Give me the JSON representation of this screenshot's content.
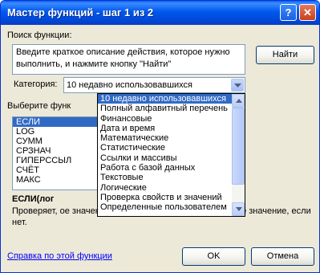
{
  "window": {
    "title": "Мастер функций - шаг 1 из 2",
    "help_glyph": "?",
    "close_glyph": "✕"
  },
  "search": {
    "label": "Поиск функции:",
    "text": "Введите краткое описание действия, которое нужно выполнить, и нажмите кнопку \"Найти\"",
    "find_button": "Найти"
  },
  "category": {
    "label": "Категория:",
    "selected": "10 недавно использовавшихся"
  },
  "functions": {
    "label": "Выберите функ",
    "items": [
      "ЕСЛИ",
      "LOG",
      "СУММ",
      "СРЗНАЧ",
      "ГИПЕРССЫЛ",
      "СЧЁТ",
      "МАКС"
    ],
    "selected_index": 0
  },
  "category_dropdown": {
    "items": [
      "10 недавно использовавшихся",
      "Полный алфавитный перечень",
      "Финансовые",
      "Дата и время",
      "Математические",
      "Статистические",
      "Ссылки и массивы",
      "Работа с базой данных",
      "Текстовые",
      "Логические",
      "Проверка свойств и значений",
      "Определенные пользователем"
    ],
    "selected_index": 0
  },
  "description": {
    "signature": "ЕСЛИ(лог",
    "text": "Проверяет,                                                                         ое значение, если оно выполняется, и другое значение, если нет."
  },
  "footer": {
    "help_link": "Справка по этой функции",
    "ok_button": "OK",
    "cancel_button": "Отмена"
  }
}
